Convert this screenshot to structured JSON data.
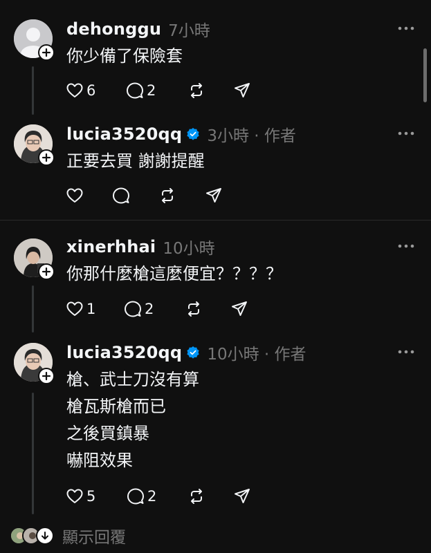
{
  "colors": {
    "background": "#101010",
    "text": "#f3f5f7",
    "muted": "#777777",
    "verified": "#0095f6",
    "thread_line": "#333638"
  },
  "posts": [
    {
      "username": "dehonggu",
      "verified": false,
      "meta": "7小時",
      "lines": [
        "你少備了保險套"
      ],
      "likes": "6",
      "replies": "2",
      "avatar_icon": "default-avatar"
    },
    {
      "username": "lucia3520qq",
      "verified": true,
      "meta": "3小時 · 作者",
      "lines": [
        "正要去買 謝謝提醒"
      ],
      "likes": "",
      "replies": "",
      "avatar_icon": "photo-avatar"
    },
    {
      "username": "xinerhhai",
      "verified": false,
      "meta": "10小時",
      "lines": [
        "你那什麼槍這麼便宜？？？？"
      ],
      "likes": "1",
      "replies": "2",
      "avatar_icon": "photo-avatar"
    },
    {
      "username": "lucia3520qq",
      "verified": true,
      "meta": "10小時 · 作者",
      "lines": [
        "槍、武士刀沒有算",
        "槍瓦斯槍而已",
        "之後買鎮暴",
        "嚇阻效果"
      ],
      "likes": "5",
      "replies": "2",
      "avatar_icon": "photo-avatar"
    }
  ],
  "footer": {
    "show_replies": "顯示回覆"
  }
}
